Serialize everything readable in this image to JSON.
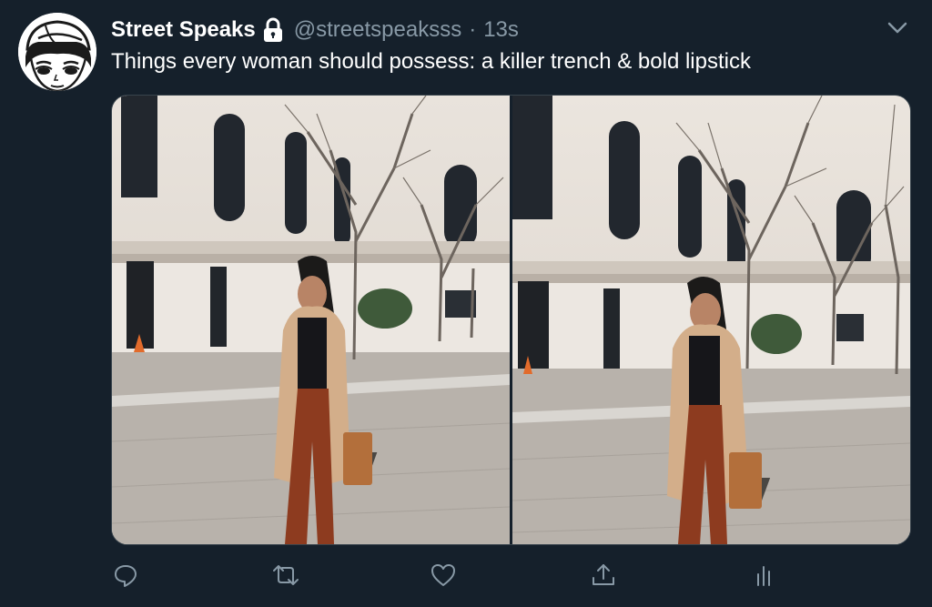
{
  "tweet": {
    "display_name": "Street Speaks",
    "handle": "@streetspeaksss",
    "separator": "·",
    "timestamp": "13s",
    "text": "Things every woman should possess: a killer trench & bold lipstick",
    "protected_icon": "lock-icon",
    "avatar": "cartoon-girl-avatar",
    "menu_icon": "chevron-down-icon"
  },
  "media": {
    "count": 2,
    "photos": [
      {
        "subject": "woman-in-camel-trench-coat"
      },
      {
        "subject": "woman-in-camel-trench-coat"
      }
    ]
  },
  "actions": [
    {
      "name": "reply",
      "icon": "reply-icon"
    },
    {
      "name": "retweet",
      "icon": "retweet-icon"
    },
    {
      "name": "like",
      "icon": "heart-icon"
    },
    {
      "name": "share",
      "icon": "share-icon"
    },
    {
      "name": "analytics",
      "icon": "analytics-icon"
    }
  ],
  "colors": {
    "background": "#15202b",
    "primary_text": "#ffffff",
    "secondary_text": "#8899a6",
    "icon": "#8899a6",
    "border": "#38444d"
  }
}
